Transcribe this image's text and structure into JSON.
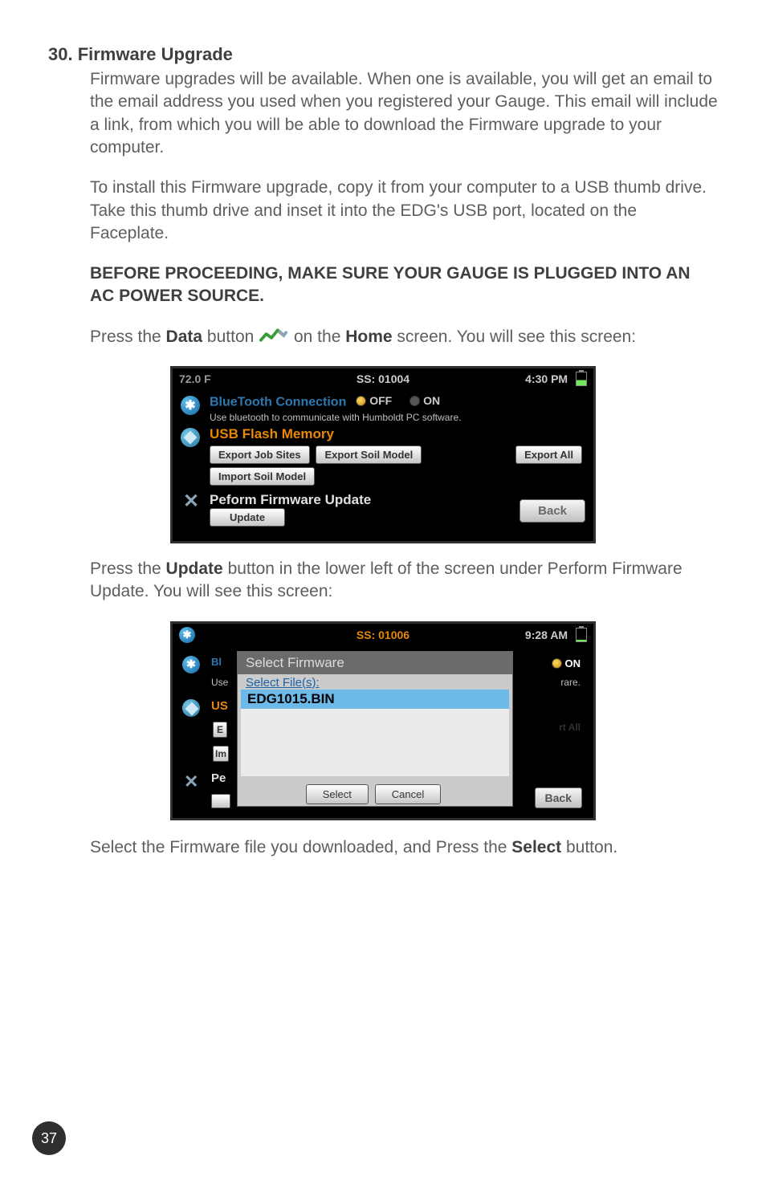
{
  "section": {
    "title": "30. Firmware Upgrade",
    "p1": "Firmware upgrades will be available. When one is available, you will get an email to the email address you used when you registered your Gauge. This email will include a link, from which you will be able to download the Firmware upgrade to your computer.",
    "p2": "To install this Firmware upgrade, copy it from your computer to a USB thumb drive. Take this thumb drive and inset it into the EDG's USB port, located on the Faceplate.",
    "warn": "BEFORE PROCEEDING, MAKE SURE YOUR GAUGE IS PLUGGED INTO AN AC POWER SOURCE.",
    "press1a": "Press the ",
    "press1b": "Data",
    "press1c": " button ",
    "press1d": " on the ",
    "press1e": "Home",
    "press1f": " screen. You will see this screen:",
    "press2a": "Press the ",
    "press2b": "Update",
    "press2c": " button in the lower left of the screen under Perform Firmware Update. You will see this screen:",
    "select1a": "Select the Firmware file you downloaded, and Press the ",
    "select1b": "Select",
    "select1c": " button."
  },
  "screen1": {
    "temp": "72.0 F",
    "ss": "SS: 01004",
    "time": "4:30 PM",
    "bt_title": "BlueTooth Connection",
    "off": "OFF",
    "on": "ON",
    "bt_hint": "Use bluetooth to communicate with Humboldt PC software.",
    "usb_title": "USB Flash Memory",
    "btn_export_jobs": "Export Job Sites",
    "btn_export_model": "Export Soil Model",
    "btn_export_all": "Export All",
    "btn_import_model": "Import Soil Model",
    "fw_title": "Peform Firmware Update",
    "btn_update": "Update",
    "btn_back": "Back"
  },
  "screen2": {
    "ss": "SS: 01006",
    "time": "9:28 AM",
    "on": "ON",
    "behind_use": "Use",
    "behind_us": "US",
    "behind_e": "E",
    "behind_im": "Im",
    "behind_pe": "Pe",
    "behind_bl": "Bl",
    "behind_rare": "rare.",
    "behind_rtall": "rt All",
    "behind_back": "Back",
    "modal_title": "Select Firmware",
    "modal_sub": "Select File(s):",
    "file": "EDG1015.BIN",
    "btn_select": "Select",
    "btn_cancel": "Cancel"
  },
  "page": "37"
}
